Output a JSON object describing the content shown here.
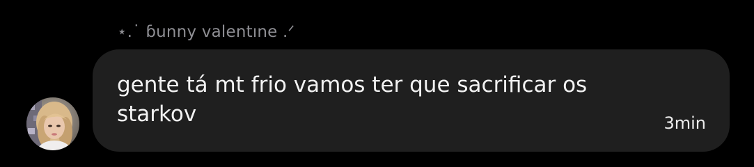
{
  "message": {
    "sender_name": "⋆.˙ ɓunny valentıne .ᐟ",
    "text": "gente tá mt frio vamos ter que sacrificar os starkov",
    "time": "3min"
  },
  "colors": {
    "background": "#000000",
    "bubble": "#1f1f1f",
    "sender_text": "#8e8e93",
    "message_text": "#f2f2f2"
  },
  "icons": {
    "avatar": "user-avatar-photo"
  }
}
